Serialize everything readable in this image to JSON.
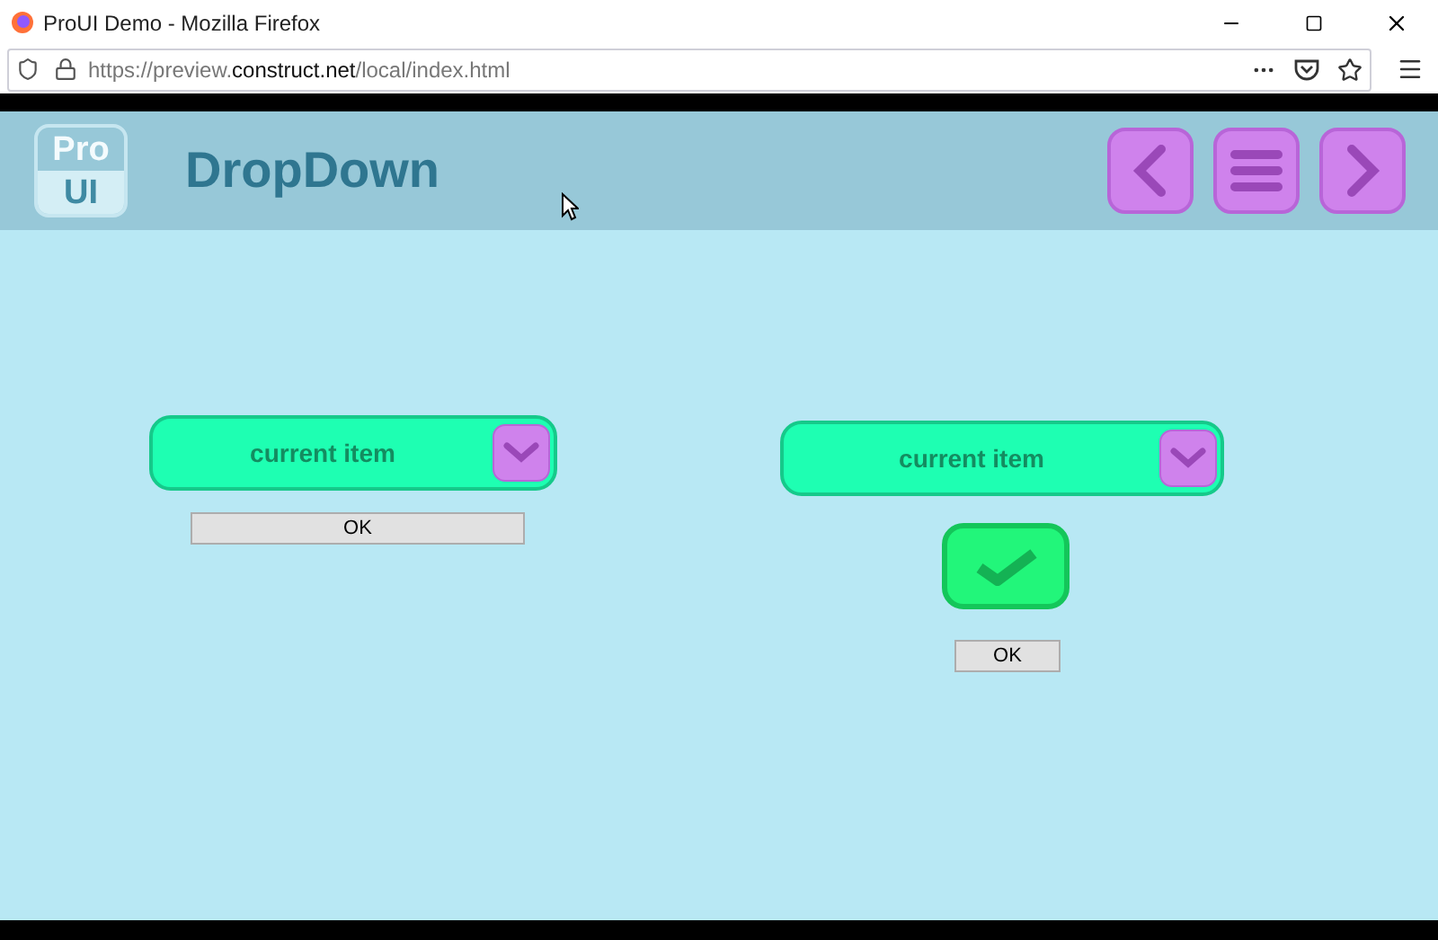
{
  "window": {
    "title": "ProUI Demo - Mozilla Firefox"
  },
  "address_bar": {
    "prefix": "https://preview.",
    "domain": "construct.net",
    "path": "/local/index.html"
  },
  "header": {
    "logo_top": "Pro",
    "logo_bottom": "UI",
    "title": "DropDown"
  },
  "dropdowns": [
    {
      "value": "current item"
    },
    {
      "value": "current item"
    }
  ],
  "ok_buttons": [
    "OK",
    "OK"
  ]
}
